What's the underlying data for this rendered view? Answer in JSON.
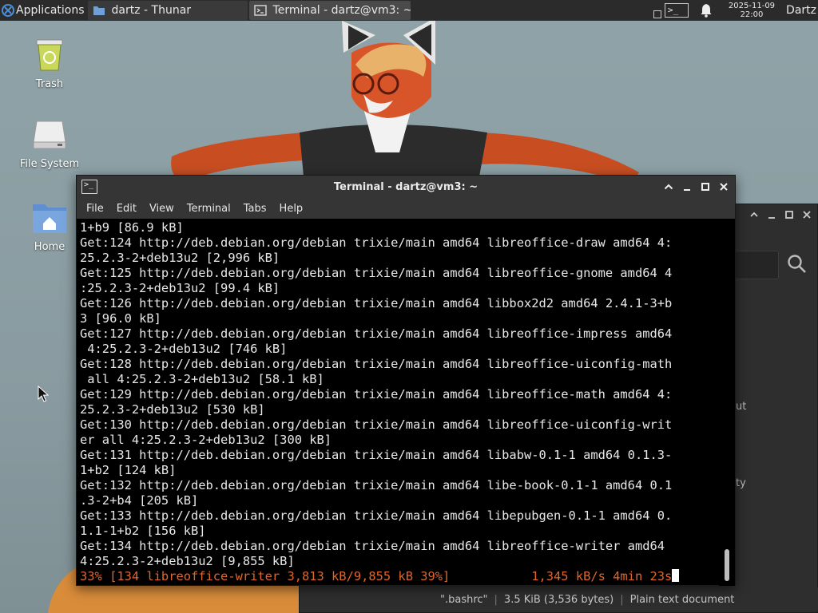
{
  "panel": {
    "applications_label": "Applications",
    "tasks": [
      {
        "label": "dartz - Thunar"
      },
      {
        "label": "Terminal - dartz@vm3: ~"
      }
    ],
    "clock_date": "2025-11-09",
    "clock_time": "22:00",
    "user": "Dartz"
  },
  "desktop_icons": [
    {
      "label": "Trash",
      "icon": "trash-icon"
    },
    {
      "label": "File System",
      "icon": "drive-icon"
    },
    {
      "label": "Home",
      "icon": "home-folder-icon"
    }
  ],
  "background_window": {
    "fragments": [
      "ut",
      "ty"
    ],
    "status": {
      "filename": "\".bashrc\"",
      "size": "3.5 KiB (3,536 bytes)",
      "type": "Plain text document"
    }
  },
  "terminal": {
    "title": "Terminal - dartz@vm3: ~",
    "menu": [
      "File",
      "Edit",
      "View",
      "Terminal",
      "Tabs",
      "Help"
    ],
    "lines": [
      "1+b9 [86.9 kB]",
      "Get:124 http://deb.debian.org/debian trixie/main amd64 libreoffice-draw amd64 4:",
      "25.2.3-2+deb13u2 [2,996 kB]",
      "Get:125 http://deb.debian.org/debian trixie/main amd64 libreoffice-gnome amd64 4",
      ":25.2.3-2+deb13u2 [99.4 kB]",
      "Get:126 http://deb.debian.org/debian trixie/main amd64 libbox2d2 amd64 2.4.1-3+b",
      "3 [96.0 kB]",
      "Get:127 http://deb.debian.org/debian trixie/main amd64 libreoffice-impress amd64",
      " 4:25.2.3-2+deb13u2 [746 kB]",
      "Get:128 http://deb.debian.org/debian trixie/main amd64 libreoffice-uiconfig-math",
      " all 4:25.2.3-2+deb13u2 [58.1 kB]",
      "Get:129 http://deb.debian.org/debian trixie/main amd64 libreoffice-math amd64 4:",
      "25.2.3-2+deb13u2 [530 kB]",
      "Get:130 http://deb.debian.org/debian trixie/main amd64 libreoffice-uiconfig-writ",
      "er all 4:25.2.3-2+deb13u2 [300 kB]",
      "Get:131 http://deb.debian.org/debian trixie/main amd64 libabw-0.1-1 amd64 0.1.3-",
      "1+b2 [124 kB]",
      "Get:132 http://deb.debian.org/debian trixie/main amd64 libe-book-0.1-1 amd64 0.1",
      ".3-2+b4 [205 kB]",
      "Get:133 http://deb.debian.org/debian trixie/main amd64 libepubgen-0.1-1 amd64 0.",
      "1.1-1+b2 [156 kB]",
      "Get:134 http://deb.debian.org/debian trixie/main amd64 libreoffice-writer amd64",
      "4:25.2.3-2+deb13u2 [9,855 kB]"
    ],
    "progress_line": "33% [134 libreoffice-writer 3,813 kB/9,855 kB 39%]           1,345 kB/s 4min 23s"
  },
  "colors": {
    "panel_bg": "#2b2b2b",
    "terminal_bg": "#000000",
    "progress_text": "#e0662c",
    "titlebar_bg": "#353535"
  }
}
